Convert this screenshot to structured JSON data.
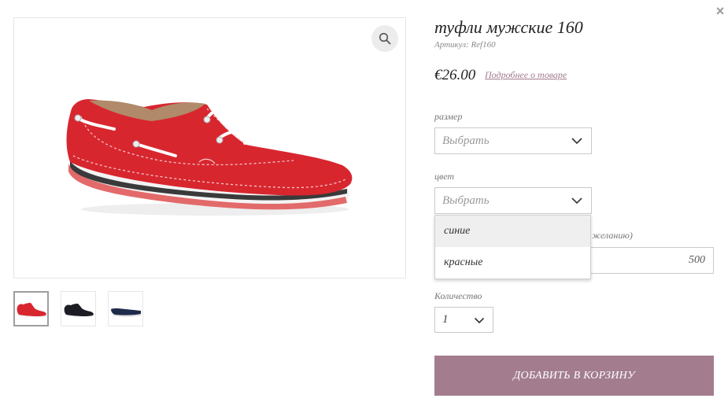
{
  "close_label": "×",
  "product": {
    "title": "туфли мужские 160",
    "sku": "Артикул: Ref160",
    "price": "€26.00",
    "details_link": "Подробнее о товаре"
  },
  "size": {
    "label": "размер",
    "value": "Выбрать"
  },
  "color": {
    "label": "цвет",
    "value": "Выбрать",
    "options": [
      "синие",
      "красные"
    ],
    "hovered_option_index": 0
  },
  "partial_field": {
    "label_fragment": "желанию)",
    "value": "500"
  },
  "quantity": {
    "label": "Количество",
    "value": "1"
  },
  "add_to_cart": "ДОБАВИТЬ В КОРЗИНУ",
  "thumbnails": [
    {
      "name": "red shoe",
      "color": "#d8262f",
      "active": true
    },
    {
      "name": "black shoe",
      "color": "#1c1c24",
      "active": false
    },
    {
      "name": "navy shoe",
      "color": "#1e2b4a",
      "active": false
    }
  ],
  "colors": {
    "accent": "#a37d8e",
    "shoe_red": "#d8262f",
    "dropdown_hover": "#efefef"
  }
}
